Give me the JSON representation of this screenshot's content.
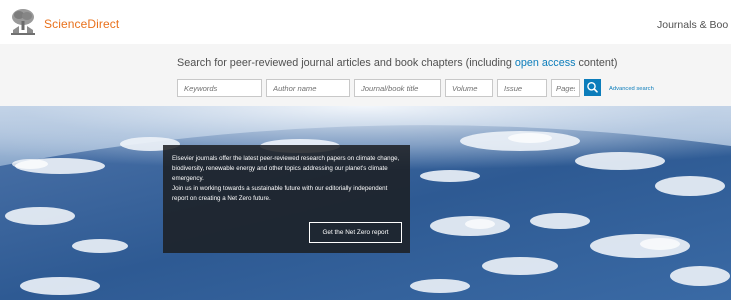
{
  "header": {
    "brand": "ScienceDirect",
    "nav_journals": "Journals & Boo"
  },
  "search": {
    "title_prefix": "Search for peer-reviewed journal articles and book chapters (including ",
    "title_link": "open access",
    "title_suffix": " content)",
    "keywords_placeholder": "Keywords",
    "author_placeholder": "Author name",
    "journal_placeholder": "Journal/book title",
    "volume_placeholder": "Volume",
    "issue_placeholder": "Issue",
    "pages_placeholder": "Pages",
    "advanced_label": "Advanced search"
  },
  "promo": {
    "paragraph1": "Elsevier journals offer the latest peer-reviewed research papers on climate change, biodiversity, renewable energy and other topics addressing our planet's climate emergency.",
    "paragraph2": "Join us in working towards a sustainable future with our editorially independent report on creating a Net Zero future.",
    "button_label": "Get the Net Zero report"
  },
  "colors": {
    "brand_orange": "#e9711c",
    "link_blue": "#0c7dbb",
    "search_band": "#f5f5f5"
  },
  "icons": [
    "elsevier-tree-logo-icon",
    "search-icon"
  ]
}
